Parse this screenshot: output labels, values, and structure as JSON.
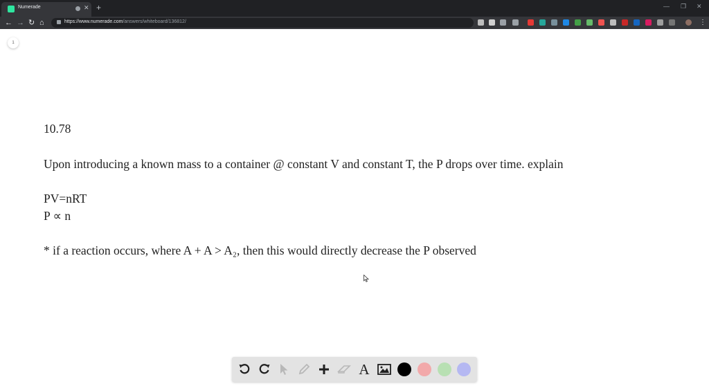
{
  "browser": {
    "tab_title": "Numerade",
    "new_tab_symbol": "+",
    "url_host": "https://www.numerade.com",
    "url_path": "/answers/whiteboard/136812/"
  },
  "page": {
    "page_number": "1",
    "lines": [
      "10.78",
      "Upon introducing a known mass to a container @ constant V and constant T, the P drops over time. explain",
      "PV=nRT",
      "P ∝ n",
      "* if a reaction occurs, where A + A > A₂, then this would directly decrease the P observed"
    ]
  },
  "toolbar": {
    "colors": [
      "#000000",
      "#f2a9aa",
      "#b8e0b3",
      "#b5b8f2"
    ]
  }
}
